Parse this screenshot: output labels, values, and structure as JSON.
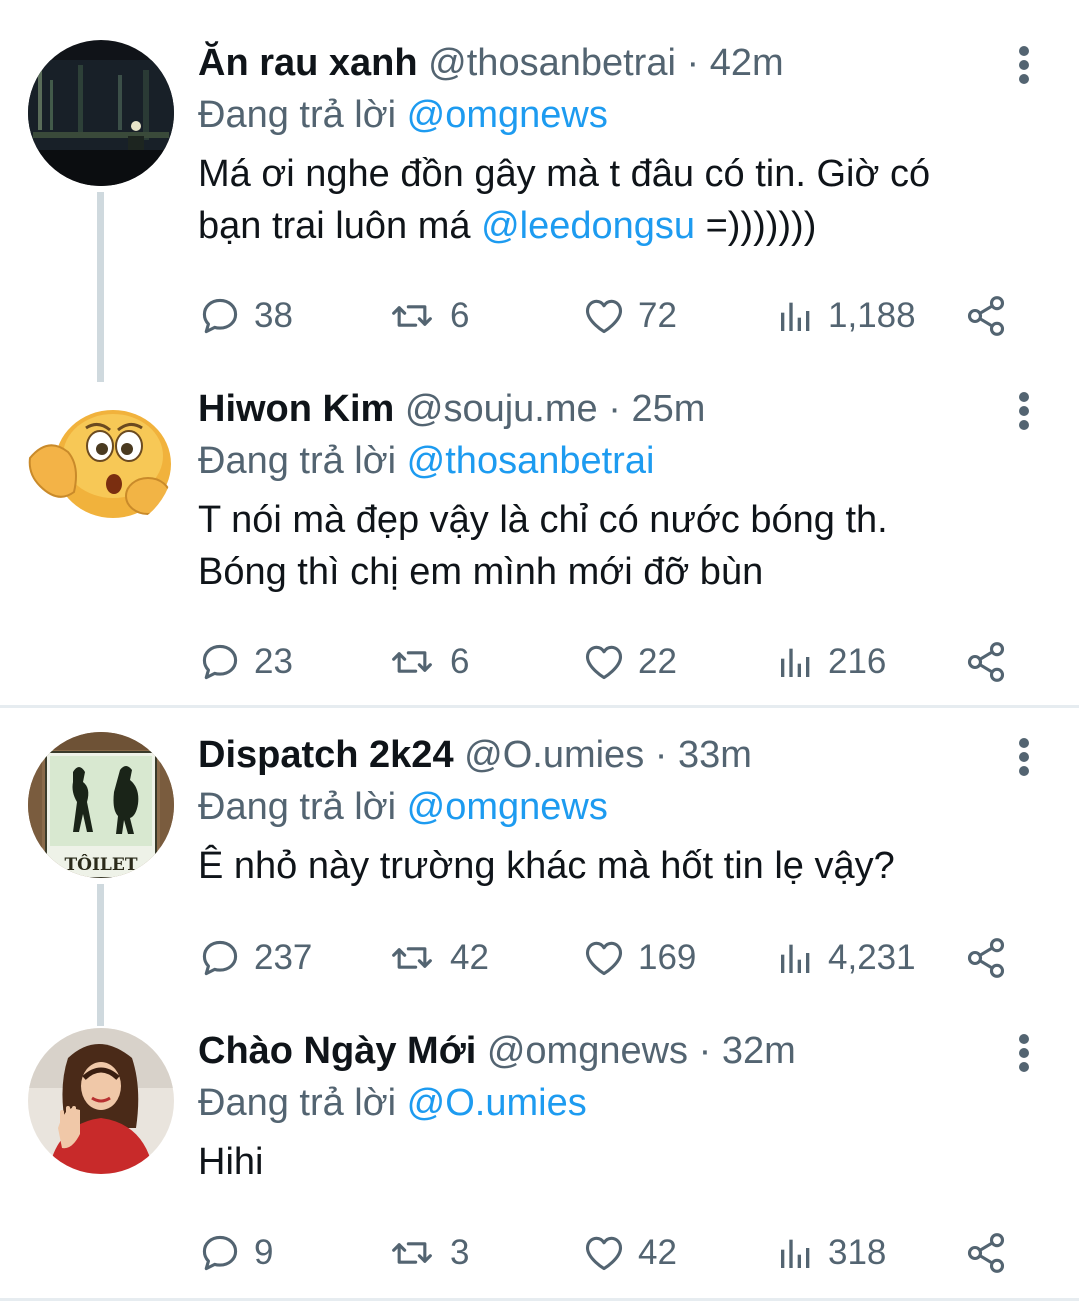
{
  "tweets": [
    {
      "name": "Ăn rau xanh",
      "handle": "@thosanbetrai",
      "dot": "·",
      "time": "42m",
      "reply_prefix": "Đang trả lời",
      "reply_to": "@omgnews",
      "text_line1": "Má ơi nghe đồn gây mà t đâu có tin. Giờ có",
      "text_line2_prefix": "bạn trai luôn má ",
      "text_mention": "@leedongsu",
      "text_line2_suffix": " =)))))))",
      "replies": "38",
      "retweets": "6",
      "likes": "72",
      "views": "1,188"
    },
    {
      "name": "Hiwon Kim",
      "handle": "@souju.me",
      "dot": "·",
      "time": "25m",
      "reply_prefix": "Đang trả lời",
      "reply_to": "@thosanbetrai",
      "text_line1": "T nói mà đẹp vậy là chỉ có nước bóng th.",
      "text_line2": "Bóng thì chị em mình mới đỡ bùn",
      "replies": "23",
      "retweets": "6",
      "likes": "22",
      "views": "216"
    },
    {
      "name": "Dispatch 2k24",
      "handle": "@O.umies",
      "dot": "·",
      "time": "33m",
      "reply_prefix": "Đang trả lời",
      "reply_to": "@omgnews",
      "text_line1": "Ê nhỏ này trường khác mà hốt tin lẹ vậy?",
      "avatar_sign": "TÔILET",
      "replies": "237",
      "retweets": "42",
      "likes": "169",
      "views": "4,231"
    },
    {
      "name": "Chào Ngày Mới",
      "handle": "@omgnews",
      "dot": "·",
      "time": "32m",
      "reply_prefix": "Đang trả lời",
      "reply_to": "@O.umies",
      "text_line1": "Hihi",
      "replies": "9",
      "retweets": "3",
      "likes": "42",
      "views": "318"
    }
  ],
  "icons": {
    "reply": "reply-icon",
    "retweet": "retweet-icon",
    "like": "heart-icon",
    "views": "views-icon",
    "share": "share-icon",
    "more": "more-icon"
  },
  "colors": {
    "text": "#0f1419",
    "secondary": "#536471",
    "mention": "#1d9bf0",
    "thread_line": "#cfd9de"
  }
}
